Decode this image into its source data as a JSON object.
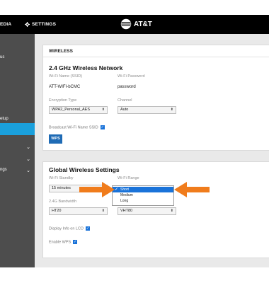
{
  "header": {
    "nav_media": "EDIA",
    "nav_settings": "SETTINGS",
    "brand": "AT&T"
  },
  "sidebar": {
    "items": [
      "us",
      "etup",
      "ngs"
    ]
  },
  "wireless_panel": {
    "title": "WIRELESS",
    "section": "2.4 GHz Wireless Network",
    "ssid_label": "Wi-Fi Name (SSID)",
    "ssid_value": "ATT-WIFI-bCMC",
    "password_label": "Wi-Fi Password",
    "password_value": "password",
    "encryption_label": "Encryption Type",
    "encryption_value": "WPA2_Personal_AES",
    "channel_label": "Channel",
    "channel_value": "Auto",
    "broadcast_label": "Broadcast Wi-Fi Name SSID",
    "wps_button": "WPS"
  },
  "global_panel": {
    "section": "Global Wireless Settings",
    "standby_label": "Wi-Fi Standby",
    "standby_value": "15 minutes",
    "range_label": "Wi-Fi Range",
    "bandwidth_label": "2.4G Bandwidth",
    "bandwidth_value": "HT20",
    "vht_value": "VHT80",
    "display_label": "Display Info on LCD",
    "enable_wps_label": "Enable WPS"
  },
  "range_dropdown": {
    "options": [
      "Short",
      "Medium",
      "Long"
    ],
    "selected": "Short"
  },
  "colors": {
    "accent": "#1aa0dc",
    "button": "#1f6bb5",
    "arrow": "#f07c1c",
    "topbar": "#000000",
    "sidebar": "#4d4d4d"
  }
}
